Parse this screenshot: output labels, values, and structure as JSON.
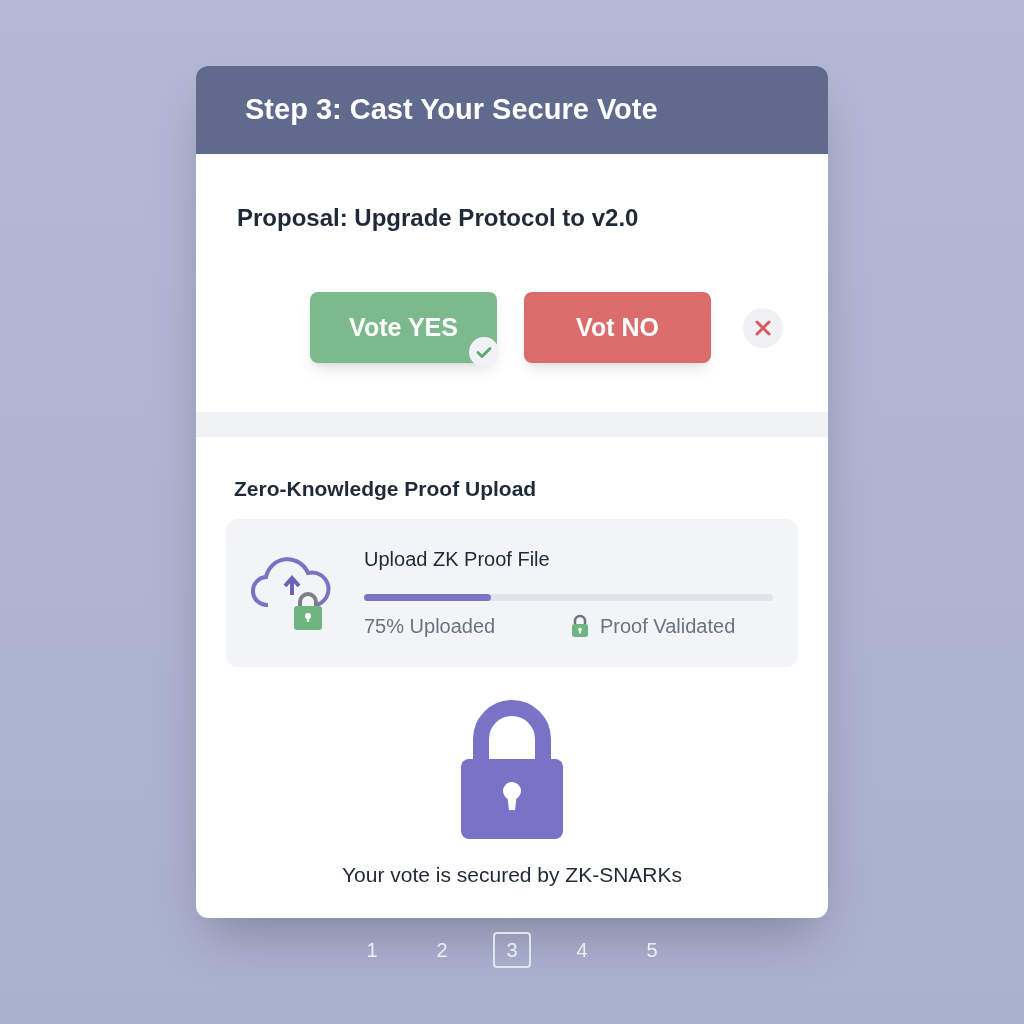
{
  "header": {
    "title": "Step 3: Cast Your Secure Vote"
  },
  "proposal": {
    "title": "Proposal: Upgrade Protocol to v2.0"
  },
  "votes": [
    {
      "label": "Vote YES",
      "kind": "yes",
      "selected": true
    },
    {
      "label": "Vot NO",
      "kind": "no",
      "selected": false
    }
  ],
  "upload": {
    "section_title": "Zero-Knowledge Proof Upload",
    "file_title": "Upload ZK Proof File",
    "level": 0.31,
    "progress_text": "75% Uploaded",
    "status": "Proof Validated"
  },
  "footer_text": "Your vote is secured by ZK-SNARKs",
  "steps": [
    {
      "label": "1",
      "selected": false
    },
    {
      "label": "2",
      "selected": false
    },
    {
      "label": "3",
      "selected": true
    },
    {
      "label": "4",
      "selected": false
    },
    {
      "label": "5",
      "selected": false
    }
  ]
}
